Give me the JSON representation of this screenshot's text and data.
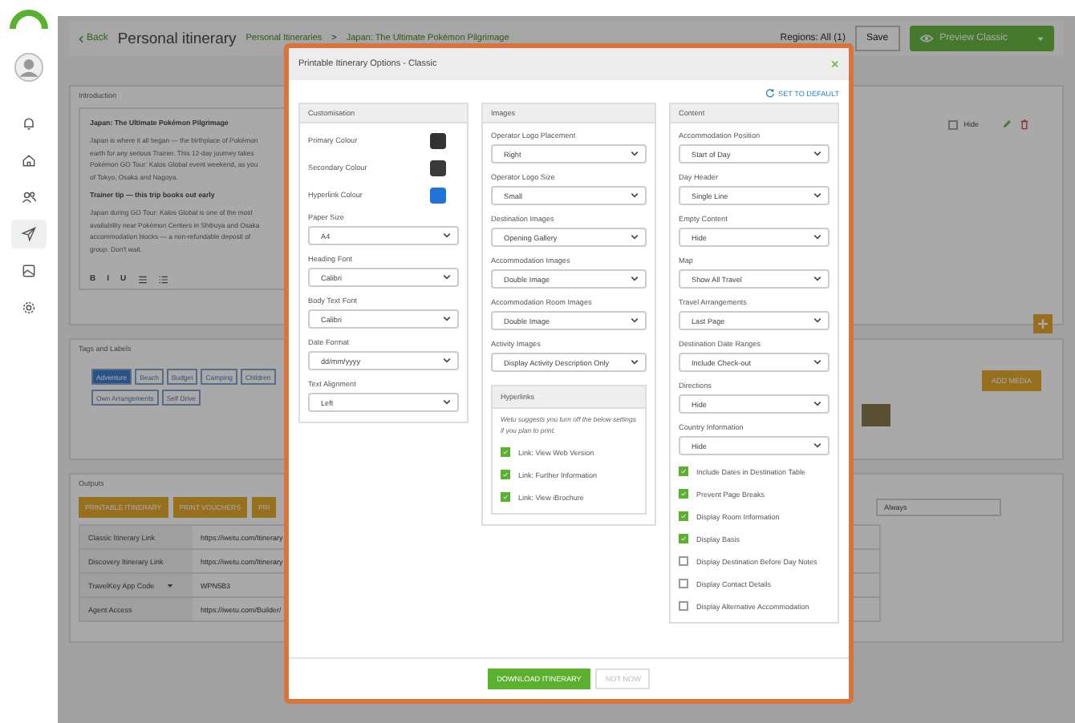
{
  "sidebar": {
    "items": [
      {
        "kind": "bell",
        "selected": false
      },
      {
        "kind": "home",
        "selected": false
      },
      {
        "kind": "people",
        "selected": false
      },
      {
        "kind": "send",
        "selected": true
      },
      {
        "kind": "image",
        "selected": false
      },
      {
        "kind": "gear",
        "selected": false
      }
    ]
  },
  "header": {
    "back": "Back",
    "title": "Personal itinerary",
    "breadcrumbs": [
      "Personal Itineraries",
      "Japan: The Ultimate Pokémon Pilgrimage"
    ],
    "separator": ">",
    "regions": "Regions: All (1)",
    "save": "Save",
    "preview": "Preview Classic"
  },
  "introduction": {
    "title": "Introduction",
    "blocks": [
      {
        "kind": "heading",
        "lines": [
          "Japan: The Ultimate Pokémon Pilgrimage"
        ]
      },
      {
        "kind": "text",
        "lines": [
          "Japan is where it all began — the birthplace of Pokémon",
          "earth for any serious Trainer. This 12-day journey takes",
          "Pokémon GO Tour: Kalos Global event weekend, as you",
          "of Tokyo, Osaka and Nagoya."
        ]
      },
      {
        "kind": "heading",
        "lines": [
          "Trainer tip — this trip books out early"
        ]
      },
      {
        "kind": "text",
        "lines": [
          "Japan during GO Tour: Kalos Global is one of the most",
          "availability near Pokémon Centers in Shibuya and Osaka",
          "accommodation blocks — a non-refundable deposit of",
          "group. Don't wait."
        ]
      }
    ],
    "format_buttons": [
      "B",
      "I",
      "U"
    ],
    "hide": {
      "label": "Hide",
      "checked": false
    }
  },
  "tags": {
    "title": "Tags and Labels",
    "items": [
      {
        "label": "Adventure",
        "selected": true
      },
      {
        "label": "Beach",
        "selected": false
      },
      {
        "label": "Budget",
        "selected": false
      },
      {
        "label": "Camping",
        "selected": false
      },
      {
        "label": "Children",
        "selected": false
      },
      {
        "label": "Own Arrangements",
        "selected": false
      },
      {
        "label": "Self Drive",
        "selected": false
      }
    ],
    "add_media": "ADD MEDIA"
  },
  "outputs": {
    "title": "Outputs",
    "buttons": [
      "PRINTABLE ITINERARY",
      "PRINT VOUCHERS",
      "PRI"
    ],
    "schedule": "Always",
    "rows": [
      {
        "label": "Classic Itinerary Link",
        "value": "https://iwetu.com/Itinerary",
        "dropdown": false
      },
      {
        "label": "Discovery Itinerary Link",
        "value": "https://iwetu.com/Itinerary",
        "dropdown": false
      },
      {
        "label": "TravelKey App Code",
        "value": "WPN5B3",
        "dropdown": true
      },
      {
        "label": "Agent Access",
        "value": "https://iwetu.com/Builder/",
        "dropdown": false
      }
    ]
  },
  "modal": {
    "title": "Printable Itinerary Options - Classic",
    "close": "×",
    "reset": "SET TO DEFAULT",
    "columns": [
      {
        "title": "Customisation",
        "fields": [
          {
            "kind": "color",
            "label": "Primary Colour",
            "color": "#333333"
          },
          {
            "kind": "color",
            "label": "Secondary Colour",
            "color": "#3a3a3a"
          },
          {
            "kind": "color",
            "label": "Hyperlink Colour",
            "color": "#1f73d8"
          },
          {
            "kind": "select",
            "label": "Paper Size",
            "value": "A4"
          },
          {
            "kind": "select",
            "label": "Heading Font",
            "value": "Calibri"
          },
          {
            "kind": "select",
            "label": "Body Text Font",
            "value": "Calibri"
          },
          {
            "kind": "select",
            "label": "Date Format",
            "value": "dd/mm/yyyy"
          },
          {
            "kind": "select",
            "label": "Text Alignment",
            "value": "Left"
          }
        ]
      },
      {
        "title": "Images",
        "fields": [
          {
            "kind": "select",
            "label": "Operator Logo Placement",
            "value": "Right"
          },
          {
            "kind": "select",
            "label": "Operator Logo Size",
            "value": "Small"
          },
          {
            "kind": "select",
            "label": "Destination Images",
            "value": "Opening Gallery"
          },
          {
            "kind": "select",
            "label": "Accommodation Images",
            "value": "Double Image"
          },
          {
            "kind": "select",
            "label": "Accommodation Room Images",
            "value": "Double Image"
          },
          {
            "kind": "select",
            "label": "Activity Images",
            "value": "Display Activity Description Only"
          },
          {
            "kind": "group",
            "title": "Hyperlinks",
            "note": "Wetu suggests you turn off the below settings if you plan to print.",
            "items": [
              {
                "label": "Link: View Web Version",
                "checked": true
              },
              {
                "label": "Link: Further Information",
                "checked": true
              },
              {
                "label": "Link: View iBrochure",
                "checked": true
              }
            ]
          }
        ]
      },
      {
        "title": "Content",
        "fields": [
          {
            "kind": "select",
            "label": "Accommodation Position",
            "value": "Start of Day"
          },
          {
            "kind": "select",
            "label": "Day Header",
            "value": "Single Line"
          },
          {
            "kind": "select",
            "label": "Empty Content",
            "value": "Hide"
          },
          {
            "kind": "select",
            "label": "Map",
            "value": "Show All Travel"
          },
          {
            "kind": "select",
            "label": "Travel Arrangements",
            "value": "Last Page"
          },
          {
            "kind": "select",
            "label": "Destination Date Ranges",
            "value": "Include Check-out"
          },
          {
            "kind": "select",
            "label": "Directions",
            "value": "Hide"
          },
          {
            "kind": "select",
            "label": "Country Information",
            "value": "Hide"
          },
          {
            "kind": "checkbox",
            "label": "Include Dates in Destination Table",
            "checked": true
          },
          {
            "kind": "checkbox",
            "label": "Prevent Page Breaks",
            "checked": true
          },
          {
            "kind": "checkbox",
            "label": "Display Room Information",
            "checked": true
          },
          {
            "kind": "checkbox",
            "label": "Display Basis",
            "checked": true
          },
          {
            "kind": "checkbox",
            "label": "Display Destination Before Day Notes",
            "checked": false
          },
          {
            "kind": "checkbox",
            "label": "Display Contact Details",
            "checked": false
          },
          {
            "kind": "checkbox",
            "label": "Display Alternative Accommodation",
            "checked": false
          }
        ]
      }
    ],
    "download": "DOWNLOAD ITINERARY",
    "dismiss": "NOT NOW"
  }
}
